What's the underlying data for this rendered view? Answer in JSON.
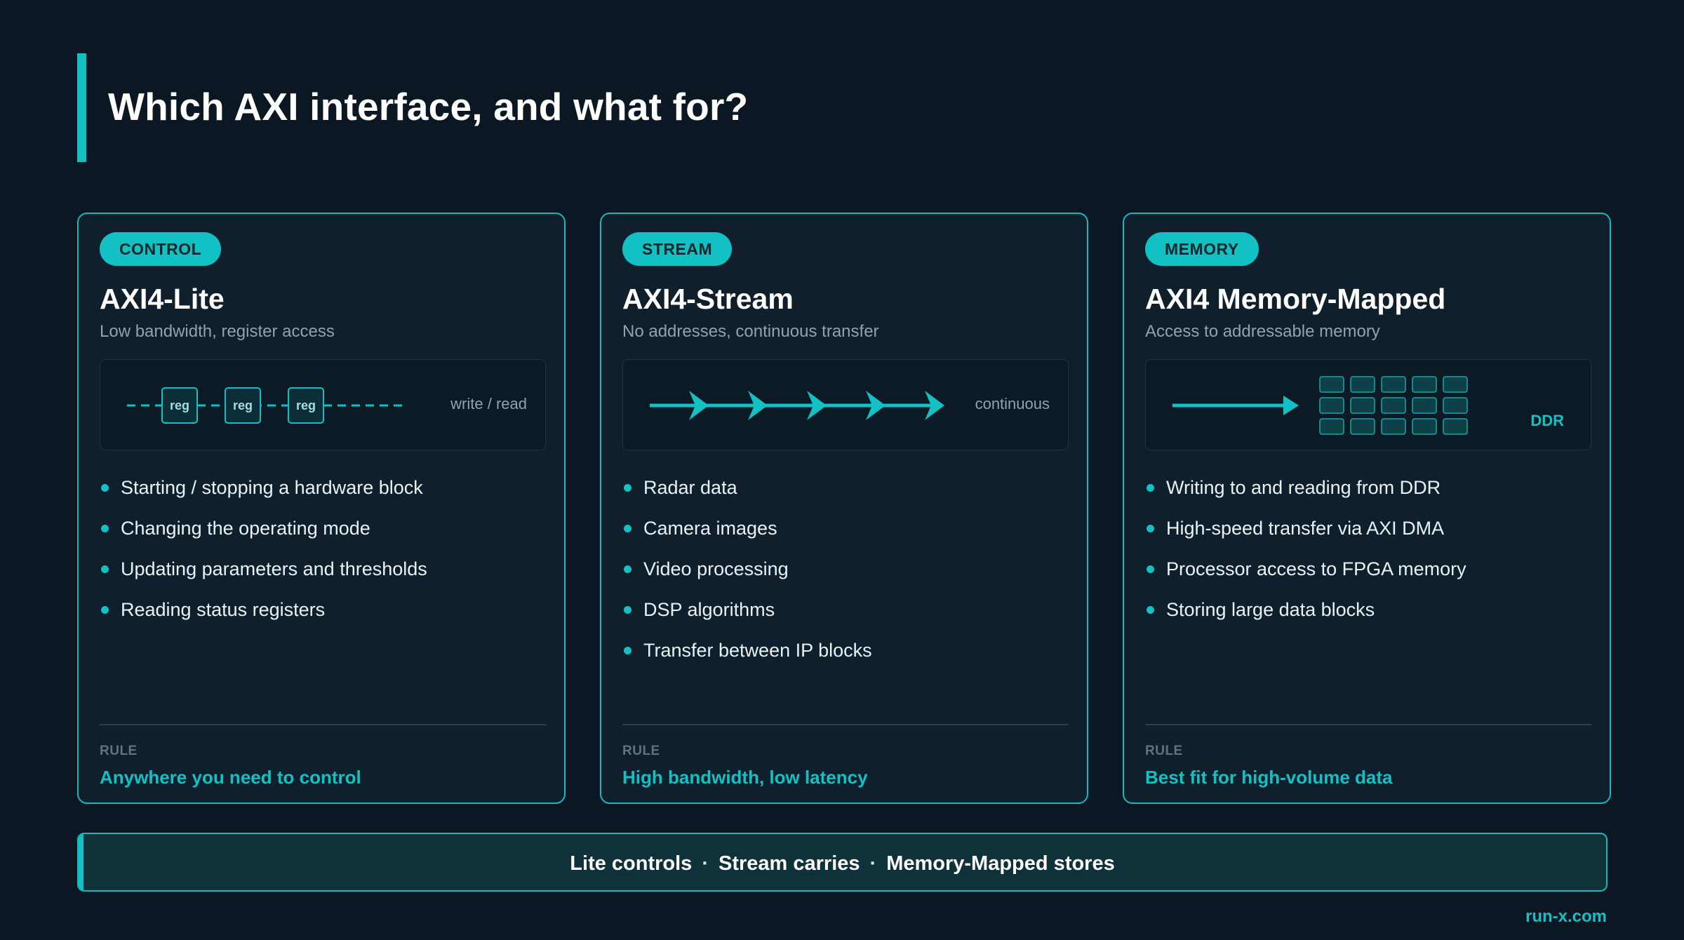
{
  "page_title": "Which AXI interface, and what for?",
  "colors": {
    "background": "#0b1823",
    "accent": "#13c0c4",
    "card_bg": "#0f1f2c"
  },
  "cards": [
    {
      "tag": "CONTROL",
      "title": "AXI4-Lite",
      "subtitle": "Low bandwidth, register access",
      "diagram": {
        "box_label": "reg",
        "side_label": "write / read"
      },
      "bullets": [
        "Starting / stopping a hardware block",
        "Changing the operating mode",
        "Updating parameters and thresholds",
        "Reading status registers"
      ],
      "rule_label": "RULE",
      "rule_text": "Anywhere you need to control"
    },
    {
      "tag": "STREAM",
      "title": "AXI4-Stream",
      "subtitle": "No addresses, continuous transfer",
      "diagram": {
        "side_label": "continuous"
      },
      "bullets": [
        "Radar data",
        "Camera images",
        "Video processing",
        "DSP algorithms",
        "Transfer between IP blocks"
      ],
      "rule_label": "RULE",
      "rule_text": "High bandwidth, low latency"
    },
    {
      "tag": "MEMORY",
      "title": "AXI4 Memory-Mapped",
      "subtitle": "Access to addressable memory",
      "diagram": {
        "side_label": "DDR"
      },
      "bullets": [
        "Writing to and reading from DDR",
        "High-speed transfer via AXI DMA",
        "Processor access to FPGA memory",
        "Storing large data blocks"
      ],
      "rule_label": "RULE",
      "rule_text": "Best fit for high-volume data"
    }
  ],
  "summary": {
    "part1": "Lite controls",
    "separator": "·",
    "part2": "Stream carries",
    "part3": "Memory-Mapped stores"
  },
  "site": "run-x.com"
}
